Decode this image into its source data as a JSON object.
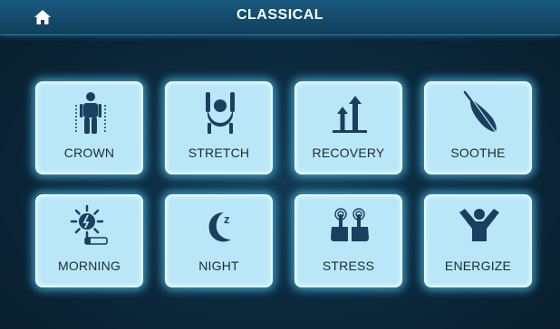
{
  "header": {
    "title": "CLASSICAL",
    "home_icon": "home-icon"
  },
  "colors": {
    "accent": "#1a5a7e",
    "tile": "#b9e7f7",
    "icon": "#1b3f5e",
    "glow": "#50c8f5"
  },
  "programs": [
    {
      "label": "CROWN",
      "icon": "crown-body-icon"
    },
    {
      "label": "STRETCH",
      "icon": "stretch-icon"
    },
    {
      "label": "RECOVERY",
      "icon": "recovery-arrows-icon"
    },
    {
      "label": "SOOTHE",
      "icon": "feather-icon"
    },
    {
      "label": "MORNING",
      "icon": "sun-icon"
    },
    {
      "label": "NIGHT",
      "icon": "moon-icon"
    },
    {
      "label": "STRESS",
      "icon": "stress-hands-icon"
    },
    {
      "label": "ENERGIZE",
      "icon": "energize-person-icon"
    }
  ]
}
